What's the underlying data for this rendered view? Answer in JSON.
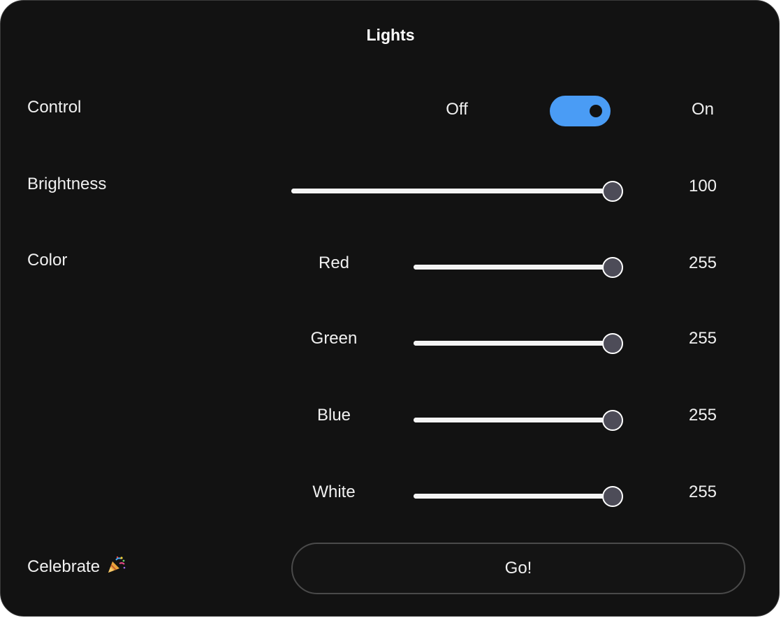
{
  "title": "Lights",
  "control": {
    "label": "Control",
    "off_label": "Off",
    "on_label": "On",
    "is_on": true
  },
  "brightness": {
    "label": "Brightness",
    "value": "100",
    "level": 1.0
  },
  "color": {
    "label": "Color",
    "channels": [
      {
        "name": "Red",
        "value": "255",
        "level": 1.0
      },
      {
        "name": "Green",
        "value": "255",
        "level": 1.0
      },
      {
        "name": "Blue",
        "value": "255",
        "level": 1.0
      },
      {
        "name": "White",
        "value": "255",
        "level": 1.0
      }
    ]
  },
  "celebrate": {
    "label": "Celebrate",
    "icon": "party-popper-icon",
    "button_label": "Go!"
  },
  "colors": {
    "background": "#121212",
    "toggle_on": "#4a9cf5",
    "thumb": "#4d4c58"
  }
}
